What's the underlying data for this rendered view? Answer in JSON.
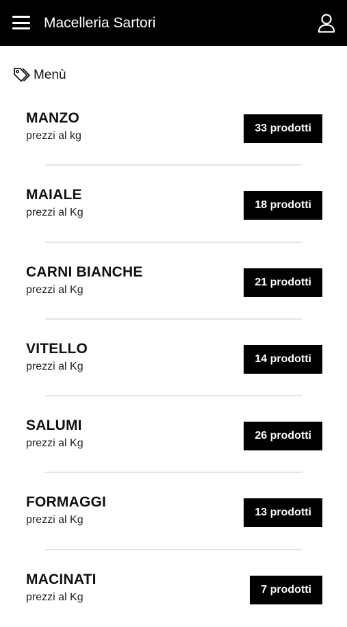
{
  "header": {
    "title": "Macelleria Sartori",
    "menu_icon": "hamburger-menu-icon",
    "user_icon": "user-icon"
  },
  "section": {
    "icon": "tag-icon",
    "title": "Menù"
  },
  "categories": [
    {
      "name": "MANZO",
      "subtitle": "prezzi al kg",
      "count": "33 prodotti"
    },
    {
      "name": "MAIALE",
      "subtitle": "prezzi al Kg",
      "count": "18 prodotti"
    },
    {
      "name": "CARNI BIANCHE",
      "subtitle": "prezzi al Kg",
      "count": "21 prodotti"
    },
    {
      "name": "VITELLO",
      "subtitle": "prezzi al Kg",
      "count": "14 prodotti"
    },
    {
      "name": "SALUMI",
      "subtitle": "prezzi al Kg",
      "count": "26 prodotti"
    },
    {
      "name": "FORMAGGI",
      "subtitle": "prezzi al Kg",
      "count": "13 prodotti"
    },
    {
      "name": "MACINATI",
      "subtitle": "prezzi al Kg",
      "count": "7 prodotti"
    }
  ],
  "colors": {
    "header_bg": "#000000",
    "badge_bg": "#000000",
    "badge_text": "#ffffff",
    "divider": "#e4e4e4"
  }
}
